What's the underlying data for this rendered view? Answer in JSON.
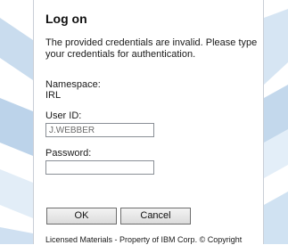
{
  "dialog": {
    "title": "Log on",
    "message": "The provided credentials are invalid. Please type your credentials for authentication.",
    "namespace_label": "Namespace:",
    "namespace_value": "IRL",
    "userid_label": "User ID:",
    "userid_value": "J.WEBBER",
    "password_label": "Password:",
    "password_value": "",
    "ok_label": "OK",
    "cancel_label": "Cancel",
    "legal_text": "Licensed Materials - Property of IBM Corp. © Copyright"
  },
  "colors": {
    "background_blue": "#bcd3ea",
    "dialog_background": "#ffffff",
    "button_border": "#6d6d6d"
  }
}
